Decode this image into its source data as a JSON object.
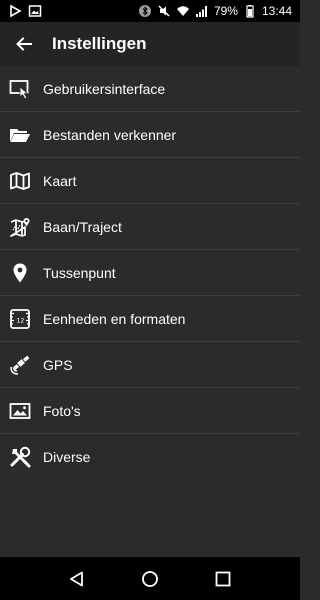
{
  "status_bar": {
    "battery": "79%",
    "time": "13:44",
    "icons": [
      "play-icon",
      "image-icon",
      "bluetooth-icon",
      "mute-icon",
      "wifi-icon",
      "signal-icon",
      "battery-icon"
    ]
  },
  "app_bar": {
    "title": "Instellingen"
  },
  "menu": {
    "items": [
      {
        "label": "Gebruikersinterface",
        "icon": "touch-screen-icon"
      },
      {
        "label": "Bestanden verkenner",
        "icon": "folder-open-icon"
      },
      {
        "label": "Kaart",
        "icon": "map-icon"
      },
      {
        "label": "Baan/Traject",
        "icon": "route-map-icon"
      },
      {
        "label": "Tussenpunt",
        "icon": "map-pin-icon"
      },
      {
        "label": "Eenheden en formaten",
        "icon": "units-ruler-icon"
      },
      {
        "label": "GPS",
        "icon": "satellite-icon"
      },
      {
        "label": "Foto's",
        "icon": "photo-icon"
      },
      {
        "label": "Diverse",
        "icon": "tools-icon"
      }
    ]
  },
  "nav_bar": {
    "buttons": [
      "back-triangle-icon",
      "home-circle-icon",
      "recents-square-icon"
    ]
  }
}
